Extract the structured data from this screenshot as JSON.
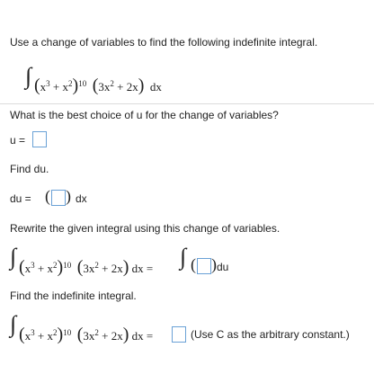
{
  "question": {
    "instruction": "Use a change of variables to find the following indefinite integral.",
    "part1": "What is the best choice of u for the change of variables?",
    "u_label": "u =",
    "part2": "Find du.",
    "du_label": "du =",
    "dx": "dx",
    "part3": "Rewrite the given integral using this change of variables.",
    "du": "du",
    "part4": "Find the indefinite integral.",
    "note": "(Use C as the arbitrary constant.)"
  },
  "integral": {
    "sign": "∫",
    "base": "x",
    "exp3": "3",
    "plus": "+",
    "exp2": "2",
    "power": "10",
    "factor": "3x",
    "factor_exp": "2",
    "factor_tail": "+ 2x",
    "dx": "dx",
    "equals": "="
  },
  "inputs": {
    "u": "",
    "du_expr": "",
    "rewrite": "",
    "answer": ""
  }
}
